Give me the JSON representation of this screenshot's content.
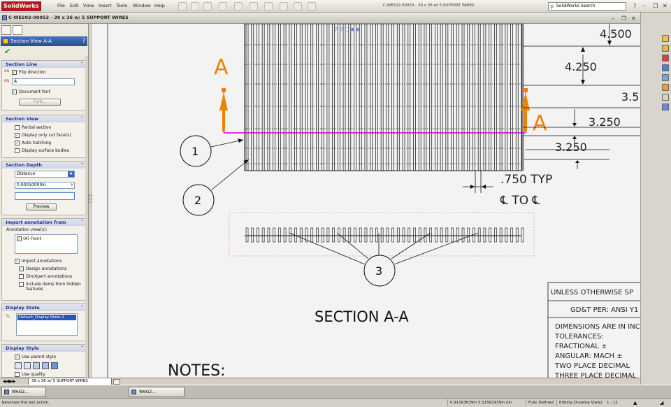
{
  "app": {
    "logo_text": "SolidWorks",
    "document_title": "C-WES02-00053 - 39 x 36 w/ 5 SUPPORT WIRES"
  },
  "menus": [
    "File",
    "Edit",
    "View",
    "Insert",
    "Tools",
    "Window",
    "Help"
  ],
  "search": {
    "placeholder": "SolidWorks Search"
  },
  "drawing_window": {
    "title": "C-WES02-00053 - 39 x 36 w/ 5 SUPPORT WIRES"
  },
  "property_manager": {
    "title": "Section View A-A",
    "help": "?",
    "section_line": {
      "header": "Section Line",
      "flip_direction": {
        "label": "Flip direction",
        "checked": true
      },
      "label_value": "A",
      "document_font": {
        "label": "Document font",
        "checked": true
      },
      "font_button": "Font..."
    },
    "section_view": {
      "header": "Section View",
      "options": [
        {
          "label": "Partial section",
          "checked": false
        },
        {
          "label": "Display only cut face(s)",
          "checked": true
        },
        {
          "label": "Auto hatching",
          "checked": true
        },
        {
          "label": "Display surface bodies",
          "checked": false
        }
      ]
    },
    "section_depth": {
      "header": "Section Depth",
      "mode": "Distance",
      "value": "0.00010000in",
      "preview_button": "Preview"
    },
    "import_annotation": {
      "header": "Import annotation from",
      "list_label": "Annotation view(s):",
      "list_item": {
        "label": "(A) Front",
        "checked": true
      },
      "options": [
        {
          "label": "Import annotations",
          "checked": true
        },
        {
          "label": "Design annotations",
          "checked": true
        },
        {
          "label": "DimXpert annotations",
          "checked": false
        },
        {
          "label": "Include items from hidden features",
          "checked": false
        }
      ]
    },
    "display_state": {
      "header": "Display State",
      "selected": "Default_Display State-1"
    },
    "display_style": {
      "header": "Display Style",
      "use_parent": {
        "label": "Use parent style",
        "checked": true
      },
      "use_quality": {
        "label": "Use quality",
        "checked": false
      }
    }
  },
  "drawing": {
    "dimensions": [
      "4.500",
      "4.250",
      "3.5",
      "3.250",
      "3.250"
    ],
    "section_letter": "A",
    "pitch_dim": ".750 TYP",
    "pitch_dim_line2": "℄ TO ℄",
    "balloons": [
      "1",
      "2",
      "3"
    ],
    "section_title": "SECTION A-A",
    "notes_title": "NOTES:",
    "title_block": [
      "UNLESS OTHERWISE SP",
      "GD&T PER:   ANSI Y1",
      "DIMENSIONS ARE IN INC",
      "TOLERANCES:",
      "FRACTIONAL ±",
      "ANGULAR: MACH ±",
      "TWO PLACE DECIMAL",
      "THREE PLACE DECIMAL"
    ]
  },
  "sheet_tab": "39 x 36 w/ 5 SUPPORT WIRES",
  "windows": [
    "W6G2...",
    "W6G2..."
  ],
  "status": {
    "message": "Reverses the last action.",
    "coords": "0.91163639in   5.01561939in   0in",
    "state": "Fully Defined",
    "mode": "Editing Drawing View2",
    "scale": "1 : 12"
  },
  "colors": {
    "section_line": "#cc00cc",
    "section_arrow": "#f08000",
    "header_blue": "#274c93"
  }
}
